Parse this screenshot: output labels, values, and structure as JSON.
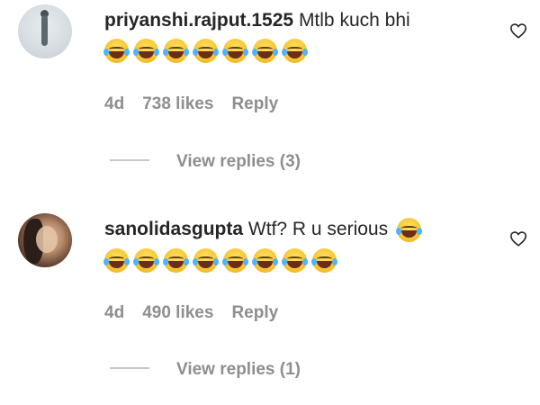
{
  "comments": [
    {
      "username": "priyanshi.rajput.1525",
      "text": "Mtlb kuch bhi",
      "inline_emoji_count": 0,
      "emoji_row_count": 7,
      "emoji_name": "face-with-tears-of-joy",
      "time": "4d",
      "likes": "738 likes",
      "reply_label": "Reply",
      "view_replies": "View replies (3)"
    },
    {
      "username": "sanolidasgupta",
      "text": "Wtf? R u serious",
      "inline_emoji_count": 1,
      "emoji_row_count": 8,
      "emoji_name": "face-with-tears-of-joy",
      "time": "4d",
      "likes": "490 likes",
      "reply_label": "Reply",
      "view_replies": "View replies (1)"
    }
  ],
  "icons": {
    "like": "heart-outline-icon"
  },
  "colors": {
    "username": "#262626",
    "meta": "#8e8e8e",
    "divider": "#c7c7c7"
  }
}
